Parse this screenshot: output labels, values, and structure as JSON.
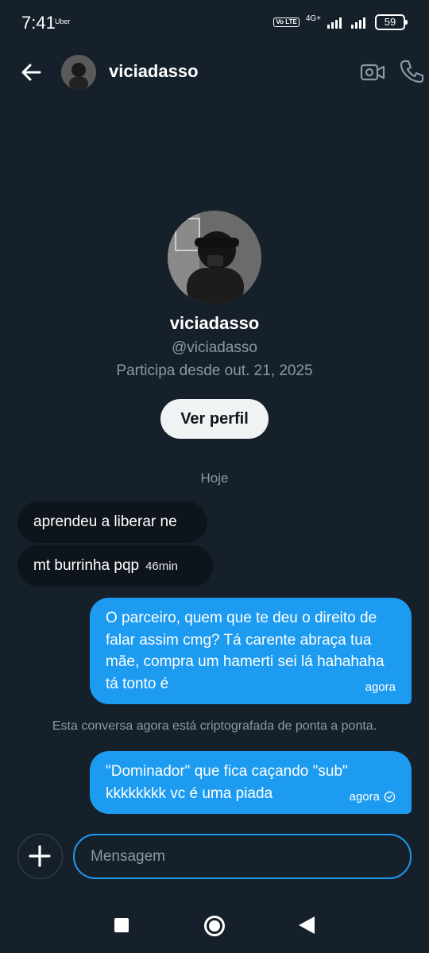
{
  "status_bar": {
    "time": "7:41",
    "notification_app": "Uber",
    "volte": "Vo LTE",
    "network": "4G+",
    "battery": "59"
  },
  "header": {
    "username": "viciadasso",
    "icons": [
      "back-arrow-icon",
      "video-call-icon",
      "phone-call-icon"
    ]
  },
  "profile": {
    "name": "viciadasso",
    "handle": "@viciadasso",
    "joined": "Participa desde out. 21, 2025",
    "view_profile_label": "Ver perfil"
  },
  "conversation": {
    "day_separator": "Hoje",
    "incoming": [
      {
        "text": "aprendeu a liberar ne",
        "time": ""
      },
      {
        "text": "mt burrinha pqp",
        "time": "46min"
      }
    ],
    "outgoing_1": {
      "text": "O parceiro, quem que te deu o direito de falar assim cmg? Tá carente abraça tua mãe, compra um hamerti sei lá hahahaha tá tonto é",
      "time": "agora"
    },
    "encryption_note": "Esta conversa agora está criptografada de ponta a ponta.",
    "outgoing_2": {
      "text": "\"Dominador\" que fica caçando \"sub\" kkkkkkkk vc é uma piada",
      "time": "agora",
      "status_icon": "check-circle-icon"
    }
  },
  "composer": {
    "placeholder": "Mensagem"
  },
  "colors": {
    "background": "#16202b",
    "accent": "#1d9bf0",
    "incoming_bubble": "#0e141b",
    "secondary_text": "#8b98a5"
  }
}
